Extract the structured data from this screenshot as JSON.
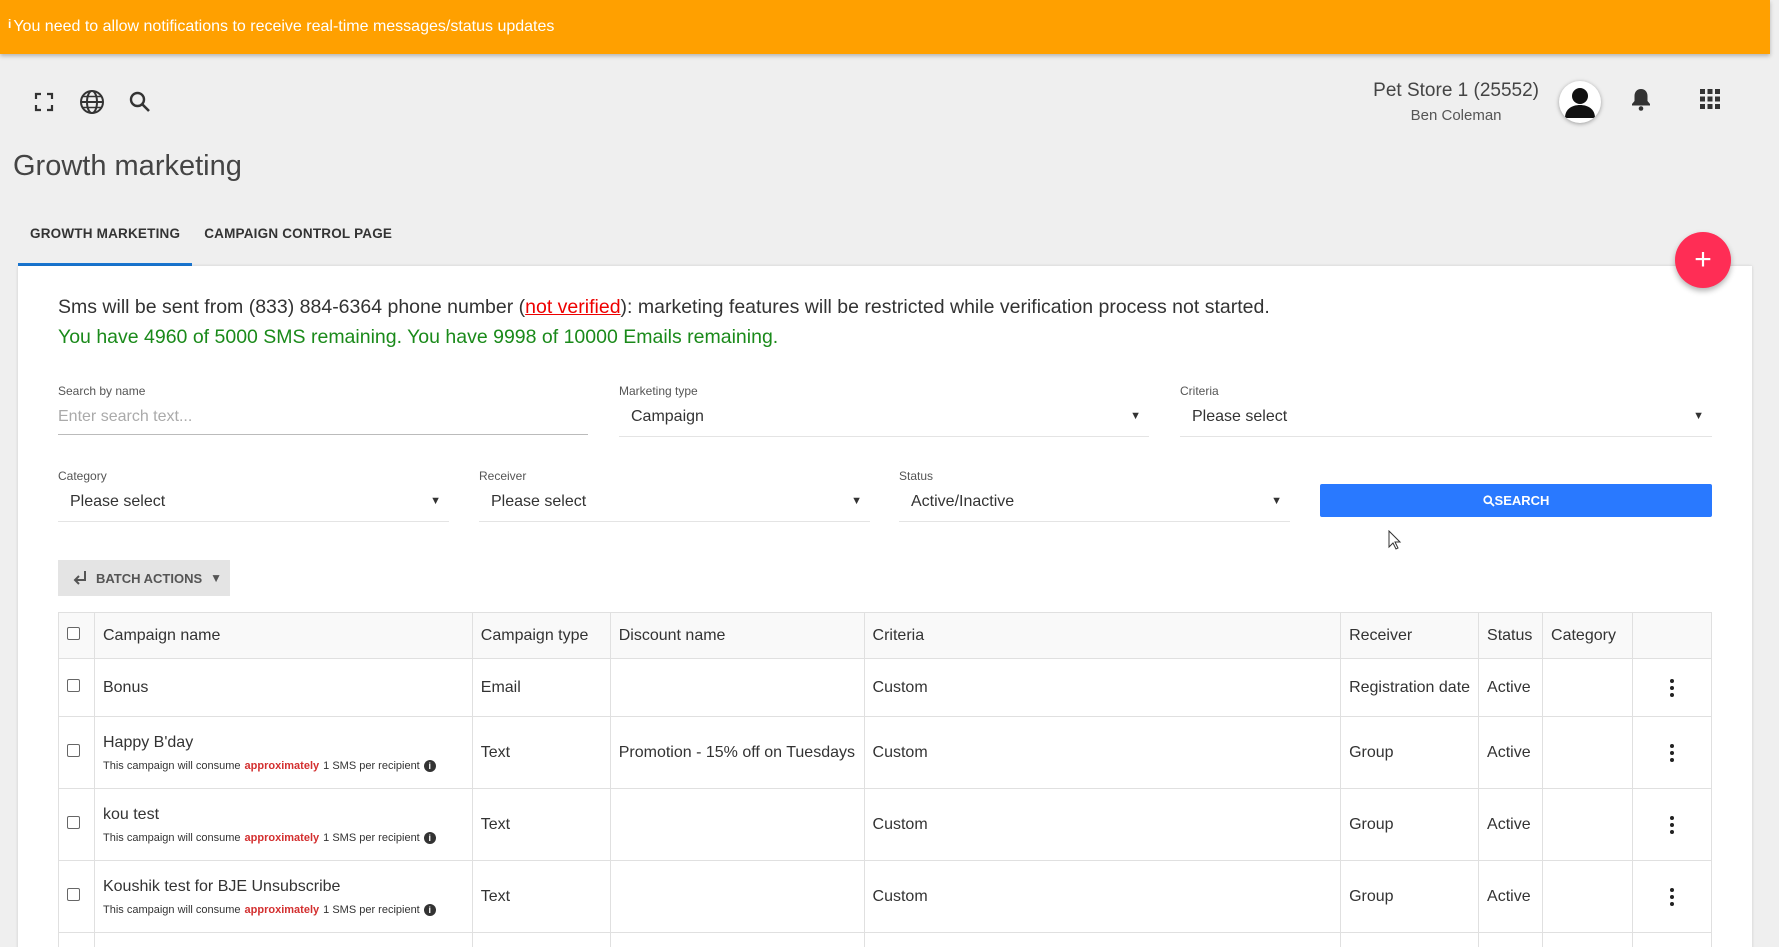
{
  "notice": {
    "text": "You need to allow notifications to receive real-time messages/status updates"
  },
  "header": {
    "icons": [
      "fullscreen-icon",
      "globe-icon",
      "search-icon"
    ],
    "store_name": "Pet Store 1 (25552)",
    "user_name": "Ben Coleman"
  },
  "page": {
    "title": "Growth marketing"
  },
  "tabs": [
    {
      "label": "GROWTH MARKETING",
      "active": true
    },
    {
      "label": "CAMPAIGN CONTROL PAGE",
      "active": false
    }
  ],
  "fab": {
    "label": "+"
  },
  "info": {
    "sms_prefix": "Sms will be sent from (833) 884-6364 phone number (",
    "not_verified": "not verified",
    "sms_suffix": "): marketing features will be restricted while verification process not started.",
    "remaining": "You have 4960 of 5000 SMS remaining. You have 9998 of 10000 Emails remaining."
  },
  "filters": {
    "search": {
      "label": "Search by name",
      "placeholder": "Enter search text...",
      "value": ""
    },
    "marketing_type": {
      "label": "Marketing type",
      "value": "Campaign"
    },
    "criteria": {
      "label": "Criteria",
      "value": "Please select"
    },
    "category": {
      "label": "Category",
      "value": "Please select"
    },
    "receiver": {
      "label": "Receiver",
      "value": "Please select"
    },
    "status": {
      "label": "Status",
      "value": "Active/Inactive"
    },
    "search_button": "SEARCH"
  },
  "batch_actions": {
    "label": "BATCH ACTIONS"
  },
  "table": {
    "columns": [
      "Campaign name",
      "Campaign type",
      "Discount name",
      "Criteria",
      "Receiver",
      "Status",
      "Category"
    ],
    "note": {
      "prefix": "This campaign will consume",
      "highlight": "approximately",
      "suffix": "1 SMS per recipient"
    },
    "rows": [
      {
        "name": "Bonus",
        "type": "Email",
        "discount": "",
        "criteria": "Custom",
        "receiver": "Registration date",
        "status": "Active",
        "category": "",
        "has_note": false
      },
      {
        "name": "Happy B'day",
        "type": "Text",
        "discount": "Promotion - 15% off on Tuesdays",
        "criteria": "Custom",
        "receiver": "Group",
        "status": "Active",
        "category": "",
        "has_note": true
      },
      {
        "name": "kou test",
        "type": "Text",
        "discount": "",
        "criteria": "Custom",
        "receiver": "Group",
        "status": "Active",
        "category": "",
        "has_note": true
      },
      {
        "name": "Koushik test for BJE Unsubscribe",
        "type": "Text",
        "discount": "",
        "criteria": "Custom",
        "receiver": "Group",
        "status": "Active",
        "category": "",
        "has_note": true
      }
    ]
  },
  "colors": {
    "notice": "#ffa000",
    "accent": "#2979ff",
    "fab": "#ff2d55",
    "remaining_text": "#1a8a1a",
    "alert": "#e00000"
  }
}
